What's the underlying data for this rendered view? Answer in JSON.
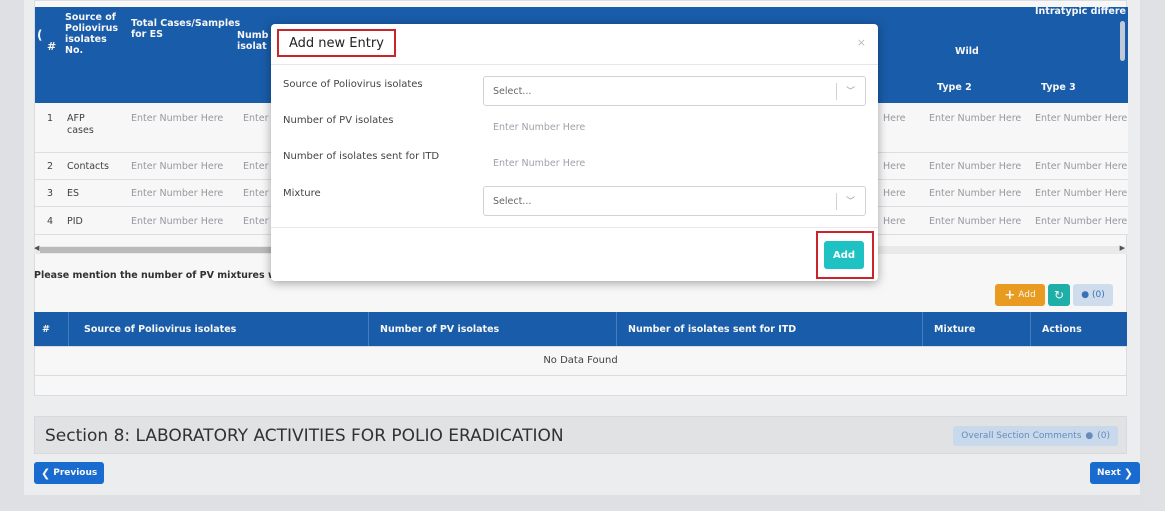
{
  "table": {
    "headers": {
      "hash": "#",
      "source": "Source of Poliovirus isolates No.",
      "total": "Total Cases/Samples for ES",
      "numb": "Numb isolat",
      "intratypic": "Intratypic differe",
      "wild": "Wild",
      "type2": "Type 2",
      "type3": "Type 3"
    },
    "placeholder": "Enter Number Here",
    "enter_cut": "Enter",
    "here_cut": "Here",
    "rows": [
      {
        "no": "1",
        "source": "AFP cases"
      },
      {
        "no": "2",
        "source": "Contacts"
      },
      {
        "no": "3",
        "source": "ES"
      },
      {
        "no": "4",
        "source": "PID"
      }
    ]
  },
  "note": "Please mention the number of PV mixtures with",
  "toolbar": {
    "add_label": "Add",
    "comments_count": "(0)"
  },
  "sub_table": {
    "headers": [
      "#",
      "Source of Poliovirus isolates",
      "Number of PV isolates",
      "Number of isolates sent for ITD",
      "Mixture",
      "Actions"
    ],
    "empty_text": "No Data Found"
  },
  "section": {
    "title": "Section 8: LABORATORY ACTIVITIES FOR POLIO ERADICATION",
    "comments_label": "Overall Section Comments",
    "comments_count": "(0)"
  },
  "nav": {
    "previous": "Previous",
    "next": "Next"
  },
  "modal": {
    "title": "Add new Entry",
    "close": "×",
    "fields": {
      "source_label": "Source of Poliovirus isolates",
      "source_value": "Select...",
      "num_label": "Number of PV isolates",
      "num_placeholder": "Enter Number Here",
      "itd_label": "Number of isolates sent for ITD",
      "itd_placeholder": "Enter Number Here",
      "mixture_label": "Mixture",
      "mixture_value": "Select..."
    },
    "add_button": "Add"
  },
  "colors": {
    "header_blue": "#1a5faf",
    "add_orange": "#f0a020",
    "refresh_teal": "#1fb5ae",
    "modal_add_teal": "#1fc2c2",
    "highlight_red": "#c9252b"
  }
}
